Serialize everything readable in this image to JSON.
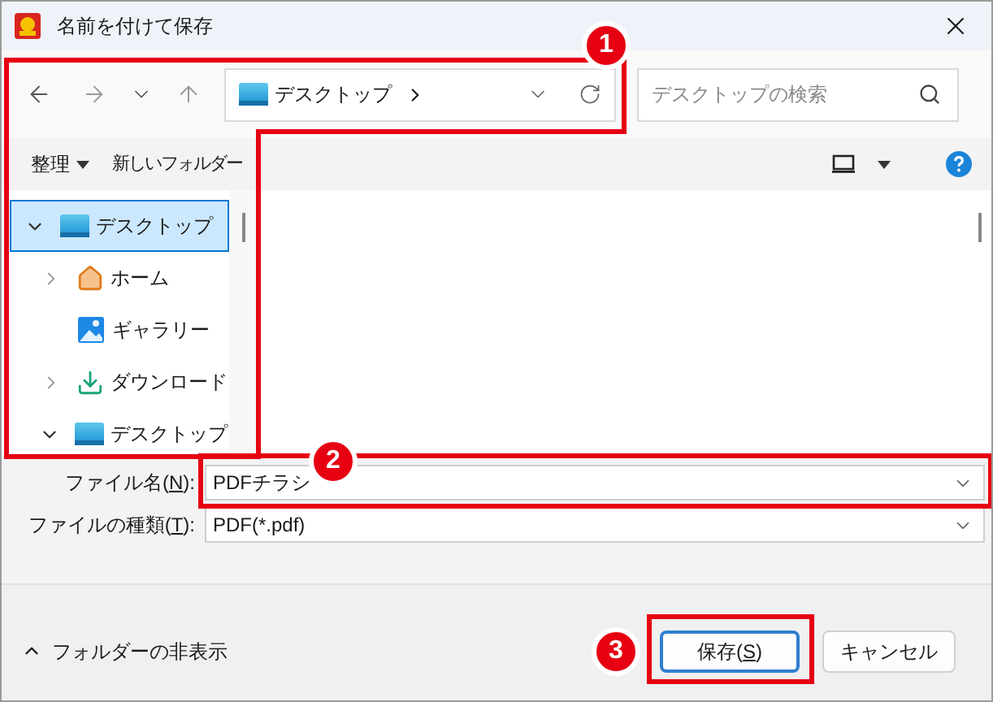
{
  "window": {
    "title": "名前を付けて保存"
  },
  "address": {
    "location": "デスクトップ",
    "search_placeholder": "デスクトップの検索"
  },
  "toolbar": {
    "organize": "整理",
    "new_folder": "新しいフォルダー"
  },
  "tree": [
    {
      "label": "デスクトップ",
      "kind": "desktop",
      "selected": true,
      "expanded": true,
      "children": [
        {
          "label": "ホーム",
          "kind": "home",
          "selected": false,
          "expanded": false
        },
        {
          "label": "ギャラリー",
          "kind": "gallery",
          "selected": false
        },
        {
          "label": "ダウンロード",
          "kind": "download",
          "selected": false,
          "expanded": false
        },
        {
          "label": "デスクトップ",
          "kind": "desktop",
          "selected": false,
          "expanded": true
        }
      ]
    }
  ],
  "fields": [
    {
      "label": "ファイル名(",
      "accel": "N",
      "label_end": "):",
      "value": "PDFチラシ"
    },
    {
      "label": "ファイルの種類(",
      "accel": "T",
      "label_end": "):",
      "value": "PDF(*.pdf)"
    }
  ],
  "footer": {
    "hide_folders": "フォルダーの非表示"
  },
  "buttons": [
    {
      "label": "保存(",
      "accel": "S",
      "label_end": ")",
      "default": true
    },
    {
      "label": "キャンセル",
      "default": false
    }
  ],
  "annotations": [
    {
      "label": "1"
    },
    {
      "label": "2"
    },
    {
      "label": "3"
    }
  ]
}
